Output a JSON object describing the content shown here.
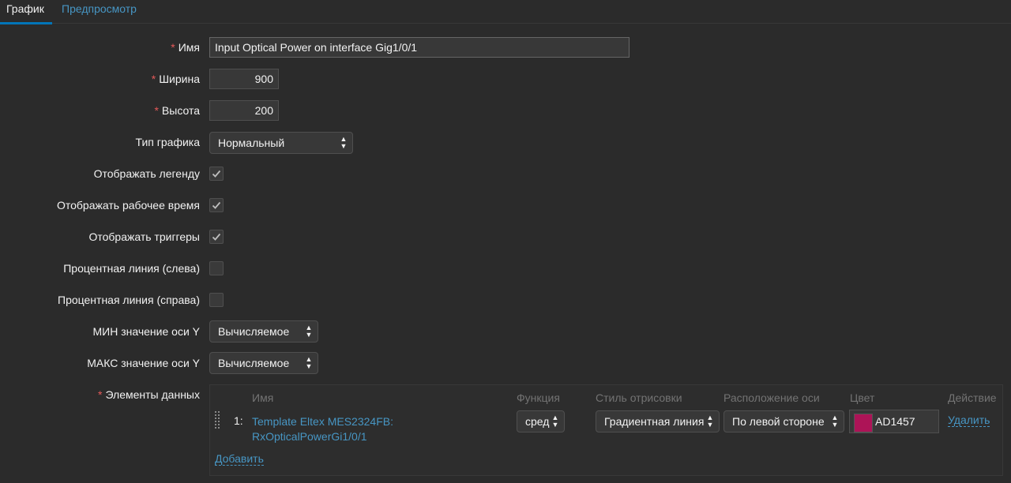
{
  "tabs": [
    {
      "label": "График"
    },
    {
      "label": "Предпросмотр"
    }
  ],
  "form": {
    "required_mark": "*",
    "name": {
      "label": "Имя",
      "value": "Input Optical Power on interface Gig1/0/1"
    },
    "width": {
      "label": "Ширина",
      "value": "900"
    },
    "height": {
      "label": "Высота",
      "value": "200"
    },
    "graph_type": {
      "label": "Тип графика",
      "value": "Нормальный"
    },
    "show_legend": {
      "label": "Отображать легенду",
      "checked": true
    },
    "show_worktime": {
      "label": "Отображать рабочее время",
      "checked": true
    },
    "show_triggers": {
      "label": "Отображать триггеры",
      "checked": true
    },
    "percentile_left": {
      "label": "Процентная линия (слева)",
      "checked": false
    },
    "percentile_right": {
      "label": "Процентная линия (справа)",
      "checked": false
    },
    "y_min": {
      "label": "МИН значение оси Y",
      "value": "Вычисляемое"
    },
    "y_max": {
      "label": "МАКС значение оси Y",
      "value": "Вычисляемое"
    },
    "items_label": "Элементы данных"
  },
  "items_table": {
    "headers": [
      "Имя",
      "Функция",
      "Стиль отрисовки",
      "Расположение оси",
      "Цвет",
      "Действие"
    ],
    "rows": [
      {
        "index": "1:",
        "name_line1": "Template Eltex MES2324FB:",
        "name_line2": "RxOpticalPowerGi1/0/1",
        "function": "сред",
        "draw_style": "Градиентная линия",
        "axis_side": "По левой стороне",
        "color_hex": "AD1457",
        "color_swatch": "#ad1457",
        "action": "Удалить"
      }
    ],
    "add_label": "Добавить"
  },
  "colors": {
    "background": "#2b2b2b",
    "link": "#4796c4",
    "accent": "#0275b8",
    "required": "#e45959"
  }
}
